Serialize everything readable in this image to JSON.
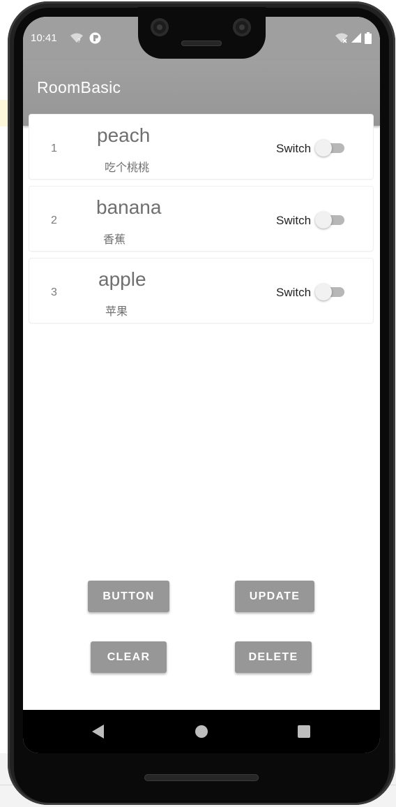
{
  "status_bar": {
    "time": "10:41"
  },
  "app_bar": {
    "title": "RoomBasic"
  },
  "words": [
    {
      "id": "1",
      "english": "peach",
      "chinese": "吃个桃桃",
      "switch_label": "Switch",
      "switch_on": false
    },
    {
      "id": "2",
      "english": "banana",
      "chinese": "香蕉",
      "switch_label": "Switch",
      "switch_on": false
    },
    {
      "id": "3",
      "english": "apple",
      "chinese": "苹果",
      "switch_label": "Switch",
      "switch_on": false
    }
  ],
  "buttons": {
    "button": "BUTTON",
    "update": "UPDATE",
    "clear": "CLEAR",
    "delete": "DELETE"
  },
  "colors": {
    "app_bar": "#969696",
    "button_bg": "#979797",
    "switch_track": "#b7b7b7"
  },
  "icons": {
    "status_left": [
      "wifi-question-icon",
      "app-notification-icon"
    ],
    "status_right": [
      "wifi-off-icon",
      "signal-icon",
      "battery-icon"
    ],
    "nav": [
      "back-icon",
      "home-icon",
      "recents-icon"
    ]
  }
}
